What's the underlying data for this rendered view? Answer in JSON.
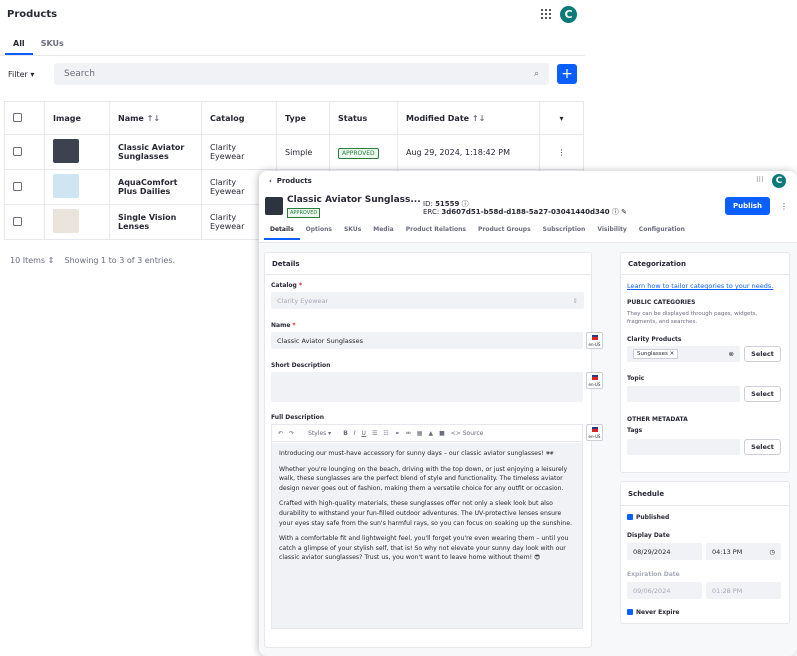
{
  "back": {
    "title": "Products",
    "avatar": "C",
    "tabs": [
      "All",
      "SKUs"
    ],
    "filter": "Filter",
    "search_placeholder": "Search",
    "plus": "+",
    "columns": [
      "Image",
      "Name",
      "Catalog",
      "Type",
      "Status",
      "Modified Date"
    ],
    "rows": [
      {
        "name": "Classic Aviator Sunglasses",
        "catalog": "Clarity Eyewear",
        "type": "Simple",
        "status": "APPROVED",
        "modified": "Aug 29, 2024, 1:18:42 PM",
        "thumb": "#3d4250"
      },
      {
        "name": "AquaComfort Plus Dailies",
        "catalog": "Clarity Eyewear",
        "thumb": "#cfe6f2"
      },
      {
        "name": "Single Vision Lenses",
        "catalog": "Clarity Eyewear",
        "thumb": "#e9e4dc"
      }
    ],
    "footer_items": "10 Items",
    "footer_showing": "Showing 1 to 3 of 3 entries."
  },
  "front": {
    "crumb": "Products",
    "avatar": "C",
    "title": "Classic Aviator Sunglass...",
    "status": "APPROVED",
    "id_label": "ID:",
    "id_value": "51559",
    "erc_label": "ERC:",
    "erc_value": "3d607d51-b58d-d188-5a27-03041440d340",
    "publish": "Publish",
    "tabs": [
      "Details",
      "Options",
      "SKUs",
      "Media",
      "Product Relations",
      "Product Groups",
      "Subscription",
      "Visibility",
      "Configuration"
    ],
    "details": {
      "header": "Details",
      "catalog_label": "Catalog",
      "catalog_value": "Clarity Eyewear",
      "name_label": "Name",
      "name_value": "Classic Aviator Sunglasses",
      "short_label": "Short Description",
      "full_label": "Full Description",
      "locale": "en-US",
      "styles": "Styles",
      "source": "Source",
      "paragraphs": [
        "Introducing our must-have accessory for sunny days – our classic aviator sunglasses! 🕶",
        "Whether you're lounging on the beach, driving with the top down, or just enjoying a leisurely walk, these sunglasses are the perfect blend of style and functionality. The timeless aviator design never goes out of fashion, making them a versatile choice for any outfit or occasion.",
        "Crafted with high-quality materials, these sunglasses offer not only a sleek look but also durability to withstand your fun-filled outdoor adventures. The UV-protective lenses ensure your eyes stay safe from the sun's harmful rays, so you can focus on soaking up the sunshine.",
        "With a comfortable fit and lightweight feel, you'll forget you're even wearing them – until you catch a glimpse of your stylish self, that is! So why not elevate your sunny day look with our classic aviator sunglasses? Trust us, you won't want to leave home without them! 😎"
      ]
    },
    "cat": {
      "header": "Categorization",
      "link": "Learn how to tailor categories to your needs.",
      "public": "PUBLIC CATEGORIES",
      "public_sub": "They can be displayed through pages, widgets, fragments, and searches.",
      "vocab": "Clarity Products",
      "tag": "Sunglasses",
      "select": "Select",
      "topic": "Topic",
      "other": "OTHER METADATA",
      "tags": "Tags"
    },
    "sched": {
      "header": "Schedule",
      "published": "Published",
      "display_label": "Display Date",
      "display_date": "08/29/2024",
      "display_time": "04:13 PM",
      "exp_label": "Expiration Date",
      "exp_date": "09/06/2024",
      "exp_time": "01:28 PM",
      "never": "Never Expire"
    }
  }
}
